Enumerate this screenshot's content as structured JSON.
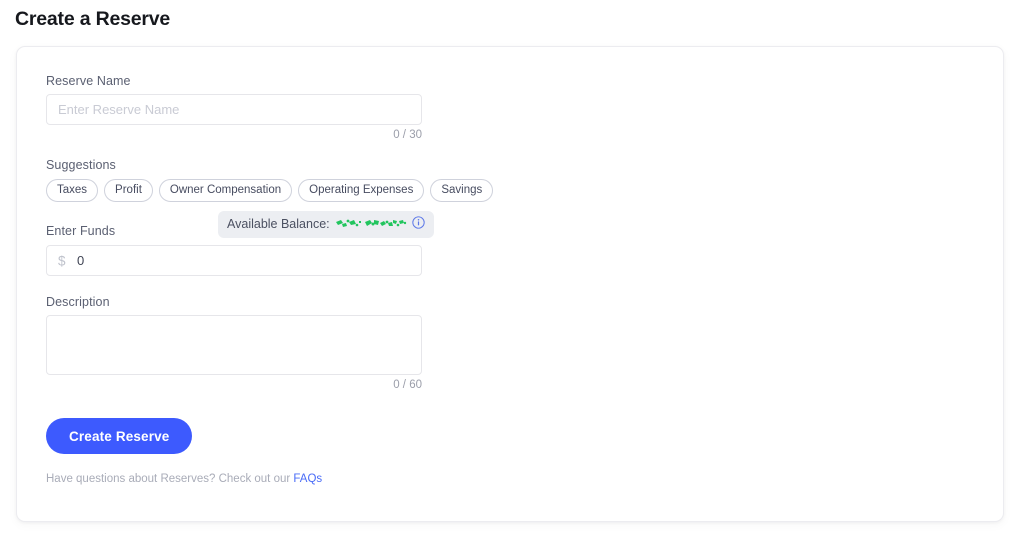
{
  "page": {
    "title": "Create a Reserve"
  },
  "form": {
    "reserve_name": {
      "label": "Reserve Name",
      "placeholder": "Enter Reserve Name",
      "value": "",
      "counter": "0 / 30"
    },
    "suggestions": {
      "label": "Suggestions",
      "chips": [
        {
          "label": "Taxes"
        },
        {
          "label": "Profit"
        },
        {
          "label": "Owner Compensation"
        },
        {
          "label": "Operating Expenses"
        },
        {
          "label": "Savings"
        }
      ]
    },
    "funds": {
      "label": "Enter Funds",
      "currency_symbol": "$",
      "value": "0",
      "placeholder": "0",
      "balance": {
        "label": "Available Balance:",
        "amount_redacted": true,
        "redaction_color": "#22c55e",
        "info_icon": "info-circle-icon"
      }
    },
    "description": {
      "label": "Description",
      "placeholder": "",
      "value": "",
      "counter": "0 / 60"
    },
    "submit": {
      "label": "Create Reserve",
      "accent_color": "#3d5afe"
    },
    "footer": {
      "text": "Have questions about Reserves? Check out our",
      "link_label": "FAQs",
      "link_color": "#4a6cf7"
    }
  }
}
